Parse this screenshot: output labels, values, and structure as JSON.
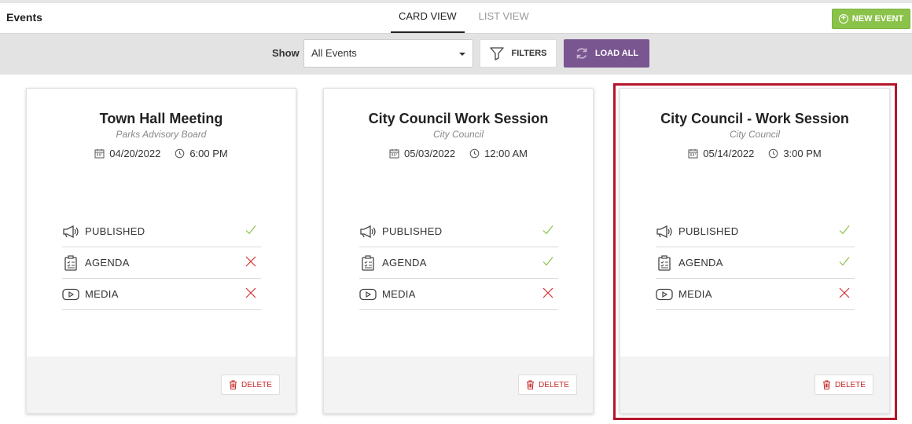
{
  "header": {
    "title": "Events",
    "tabs": [
      {
        "label": "CARD VIEW",
        "active": true
      },
      {
        "label": "LIST VIEW",
        "active": false
      }
    ],
    "new_event_label": "NEW EVENT"
  },
  "filterbar": {
    "show_label": "Show",
    "show_value": "All Events",
    "filters_label": "FILTERS",
    "load_all_label": "LOAD ALL"
  },
  "colors": {
    "accent_green": "#8bc34a",
    "accent_purple": "#7a5690",
    "check_green": "#8bc34a",
    "cross_red": "#d32f2f",
    "highlight": "#b5152b"
  },
  "cards": [
    {
      "title": "Town Hall Meeting",
      "subtitle": "Parks Advisory Board",
      "date": "04/20/2022",
      "time": "6:00 PM",
      "statuses": [
        {
          "label": "PUBLISHED",
          "icon": "megaphone-icon",
          "done": true
        },
        {
          "label": "AGENDA",
          "icon": "clipboard-icon",
          "done": false
        },
        {
          "label": "MEDIA",
          "icon": "play-icon",
          "done": false
        }
      ],
      "delete_label": "DELETE"
    },
    {
      "title": "City Council Work Session",
      "subtitle": "City Council",
      "date": "05/03/2022",
      "time": "12:00 AM",
      "statuses": [
        {
          "label": "PUBLISHED",
          "icon": "megaphone-icon",
          "done": true
        },
        {
          "label": "AGENDA",
          "icon": "clipboard-icon",
          "done": true
        },
        {
          "label": "MEDIA",
          "icon": "play-icon",
          "done": false
        }
      ],
      "delete_label": "DELETE"
    },
    {
      "title": "City Council - Work Session",
      "subtitle": "City Council",
      "date": "05/14/2022",
      "time": "3:00 PM",
      "statuses": [
        {
          "label": "PUBLISHED",
          "icon": "megaphone-icon",
          "done": true
        },
        {
          "label": "AGENDA",
          "icon": "clipboard-icon",
          "done": true
        },
        {
          "label": "MEDIA",
          "icon": "play-icon",
          "done": false
        }
      ],
      "delete_label": "DELETE"
    }
  ]
}
